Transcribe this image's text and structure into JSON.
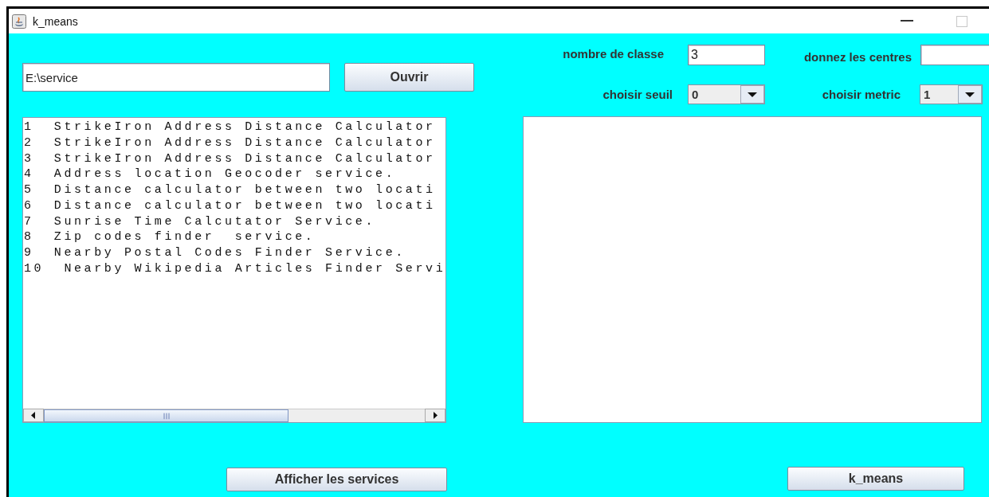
{
  "window": {
    "title": "k_means"
  },
  "file_path": {
    "value": "E:\\service"
  },
  "open_button": "Ouvrir",
  "services_list": {
    "lines": [
      "1  StrikeIron Address Distance Calculator",
      "2  StrikeIron Address Distance Calculator",
      "3  StrikeIron Address Distance Calculator",
      "4  Address location Geocoder service.",
      "5  Distance calculator between two locati",
      "6  Distance calculator between two locati",
      "7  Sunrise Time Calcutator Service.",
      "8  Zip codes finder  service.",
      "9  Nearby Postal Codes Finder Service.",
      "10  Nearby Wikipedia Articles Finder Servi"
    ]
  },
  "show_services_button": "Afficher les services",
  "parameters": [
    {
      "kind": "field",
      "label": "nombre de classe",
      "value": "3"
    },
    {
      "kind": "field",
      "label": "donnez les centres"
    },
    {
      "kind": "combo",
      "label": "choisir seuil",
      "value": "0"
    },
    {
      "kind": "combo",
      "label": "choisir metric",
      "value": "1"
    }
  ],
  "kmeans_button": "k_means"
}
